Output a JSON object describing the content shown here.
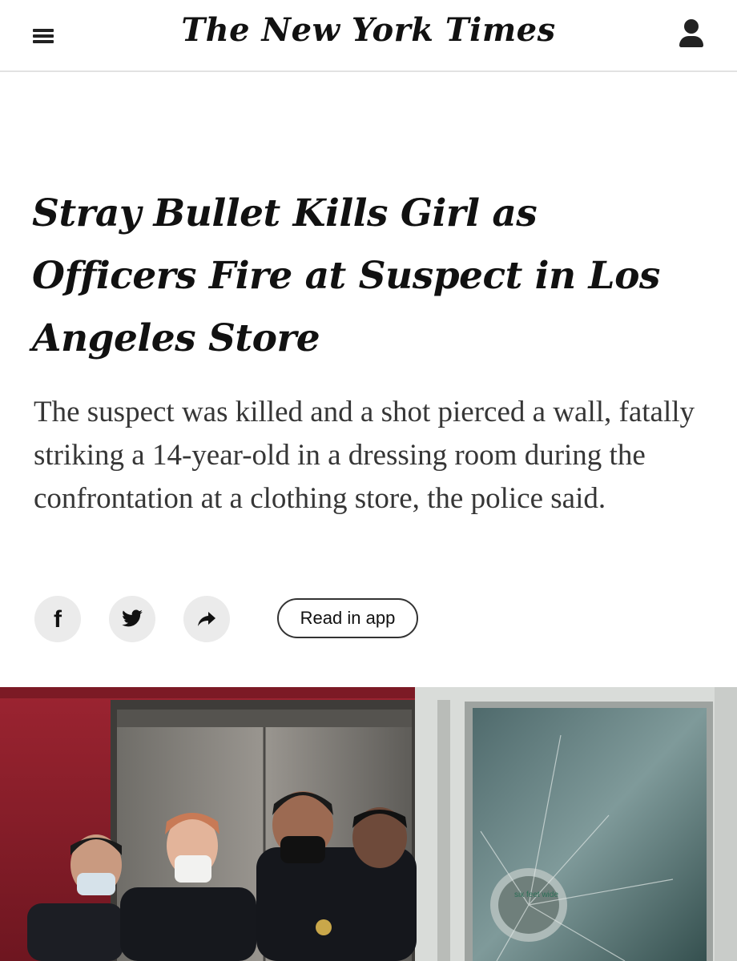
{
  "header": {
    "logo_text": "The New York Times",
    "menu_icon": "hamburger-menu-icon",
    "account_icon": "account-icon"
  },
  "article": {
    "headline": "Stray Bullet Kills Girl as Officers Fire at Suspect in Los Angeles Store",
    "summary": "The suspect was killed and a shot pierced a wall, fatally striking a 14-year-old in a dressing room during the confrontation at a clothing store, the police said."
  },
  "share": {
    "buttons": [
      {
        "icon": "facebook-icon"
      },
      {
        "icon": "twitter-icon"
      },
      {
        "icon": "share-arrow-icon"
      }
    ],
    "read_in_app_label": "Read in app"
  },
  "lead_image": {
    "glass_sign_text": "six feet wide"
  },
  "colors": {
    "text": "#121212",
    "summary_text": "#363636",
    "divider": "#e2e2e2",
    "share_button_bg": "#ebebeb",
    "storefront_red": "#8c1f2b"
  }
}
